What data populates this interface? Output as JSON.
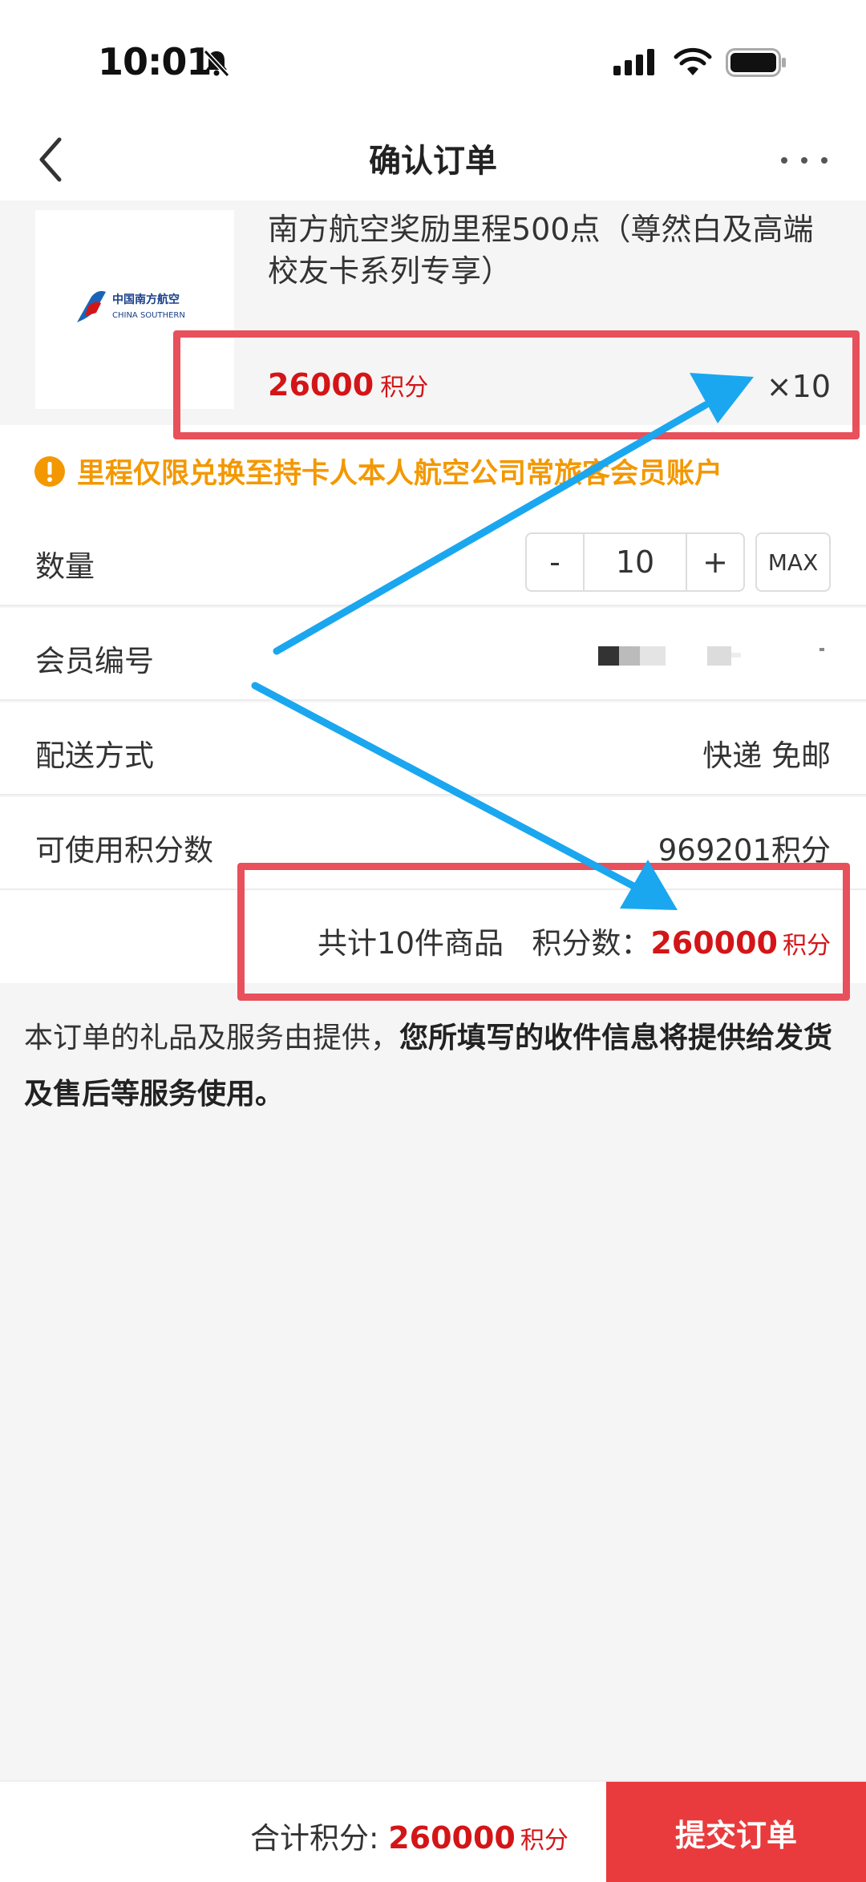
{
  "status_bar": {
    "time": "10:01"
  },
  "nav": {
    "title": "确认订单"
  },
  "product": {
    "name": "南方航空奖励里程500点（尊然白及高端校友卡系列专享）",
    "price": "26000",
    "price_unit": "积分",
    "quantity": "×10",
    "logo_text_cn": "中国南方航空",
    "logo_text_en": "CHINA SOUTHERN"
  },
  "notice": {
    "text": "里程仅限兑换至持卡人本人航空公司常旅客会员账户"
  },
  "rows": {
    "quantity": {
      "label": "数量",
      "minus": "-",
      "value": "10",
      "plus": "+",
      "max": "MAX"
    },
    "member": {
      "label": "会员编号"
    },
    "delivery": {
      "label": "配送方式",
      "value": "快递 免邮"
    },
    "points": {
      "label": "可使用积分数",
      "value": "969201积分"
    }
  },
  "summary": {
    "prefix": "共计10件商品   积分数：",
    "amount": "260000",
    "unit": "积分"
  },
  "terms": {
    "normal": "本订单的礼品及服务由提供，",
    "bold": "您所填写的收件信息将提供给发货及售后等服务使用。"
  },
  "bottom": {
    "label": "合计积分: ",
    "amount": "260000",
    "unit": "积分",
    "submit": "提交订单"
  },
  "colors": {
    "accent_red": "#d31518",
    "submit_red": "#e93b3d",
    "notice_orange": "#f39800",
    "annotation_red": "#e8505b",
    "annotation_arrow": "#1aa7ef"
  }
}
